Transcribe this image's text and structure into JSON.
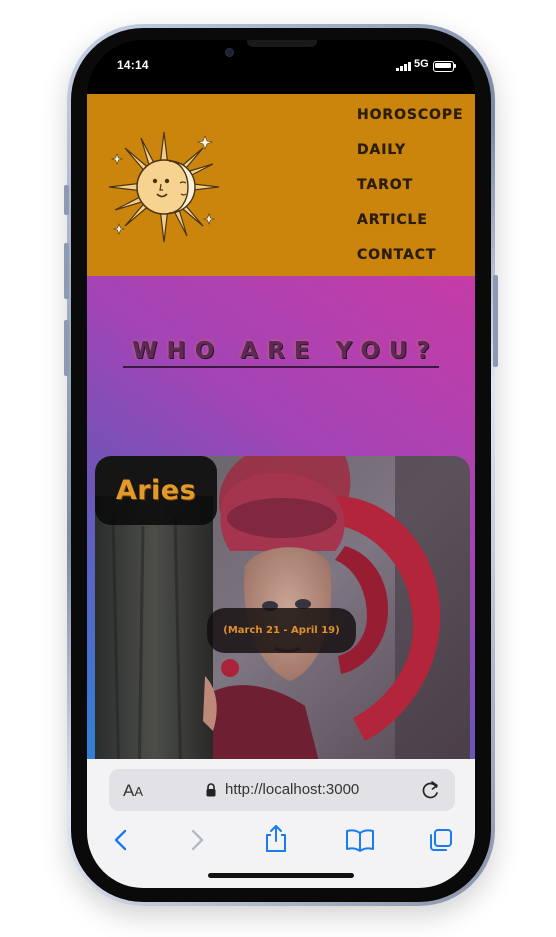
{
  "status_bar": {
    "time": "14:14",
    "network": "5G"
  },
  "nav": {
    "items": [
      {
        "label": "HOROSCOPE"
      },
      {
        "label": "DAILY"
      },
      {
        "label": "TAROT"
      },
      {
        "label": "ARTICLE"
      },
      {
        "label": "CONTACT"
      }
    ]
  },
  "hero": {
    "title": "WHO ARE YOU?"
  },
  "card": {
    "title": "Aries",
    "dates": "(March 21 - April 19)"
  },
  "browser": {
    "text_size_label": "AA",
    "url": "http://localhost:3000"
  },
  "colors": {
    "header_bg": "#cc850c",
    "accent": "#e29a2b",
    "safari_blue": "#1a7cf0"
  },
  "icons": [
    "sun-moon-logo-icon",
    "lock-icon",
    "reload-icon",
    "back-icon",
    "forward-icon",
    "share-icon",
    "bookmarks-icon",
    "tabs-icon"
  ]
}
